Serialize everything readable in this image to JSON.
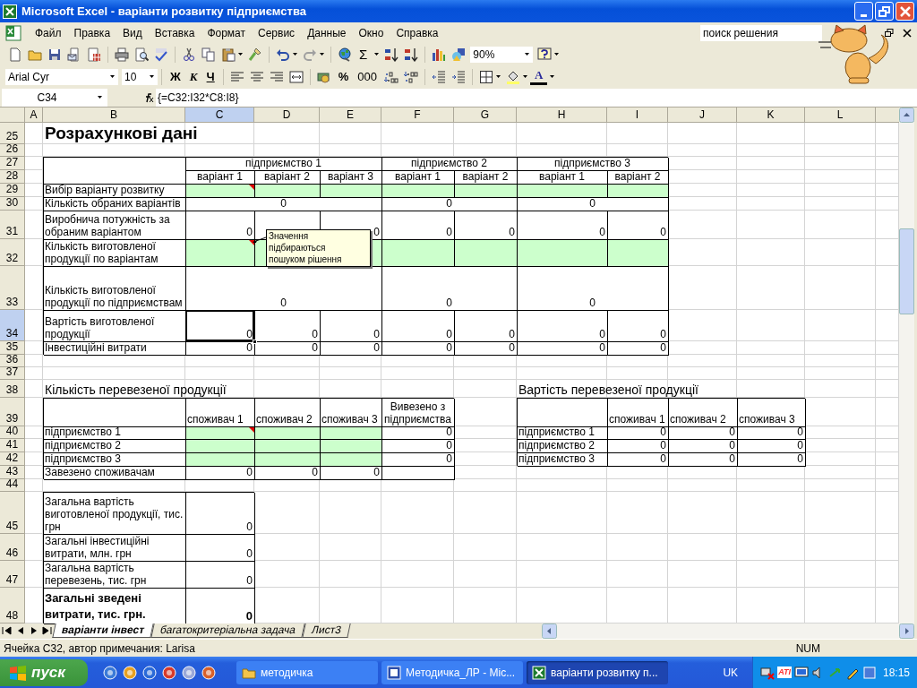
{
  "window": {
    "title": "Microsoft Excel - варіанти розвитку підприємства"
  },
  "menu": [
    "Файл",
    "Правка",
    "Вид",
    "Вставка",
    "Формат",
    "Сервис",
    "Данные",
    "Окно",
    "Справка"
  ],
  "help_search": {
    "value": "поиск решения"
  },
  "toolbar_standard": [
    {
      "kind": "icon"
    },
    {
      "kind": "icon"
    },
    {
      "kind": "icon"
    },
    {
      "kind": "icon"
    },
    {
      "kind": "icon"
    },
    {
      "kind": "separator"
    },
    {
      "kind": "icon"
    },
    {
      "kind": "icon"
    },
    {
      "kind": "icon"
    },
    {
      "kind": "separator"
    },
    {
      "kind": "icon"
    },
    {
      "kind": "icon"
    },
    {
      "kind": "icon_menu"
    },
    {
      "kind": "icon"
    },
    {
      "kind": "separator"
    },
    {
      "kind": "icon_menu"
    },
    {
      "kind": "icon_menu"
    },
    {
      "kind": "separator"
    },
    {
      "kind": "icon"
    },
    {
      "kind": "text_menu",
      "label": "Σ"
    },
    {
      "kind": "icon"
    },
    {
      "kind": "icon"
    },
    {
      "kind": "separator"
    },
    {
      "kind": "icon"
    },
    {
      "kind": "icon"
    },
    {
      "kind": "zoom_combo",
      "value": "90%"
    },
    {
      "kind": "icon_menu"
    }
  ],
  "toolbar_formatting": [
    {
      "kind": "font_combo",
      "value": "Arial Cyr"
    },
    {
      "kind": "size_combo",
      "value": "10"
    },
    {
      "kind": "separator"
    },
    {
      "kind": "text",
      "label": "Ж"
    },
    {
      "kind": "text",
      "label": "К"
    },
    {
      "kind": "text",
      "label": "Ч"
    },
    {
      "kind": "separator"
    },
    {
      "kind": "icon"
    },
    {
      "kind": "icon"
    },
    {
      "kind": "icon"
    },
    {
      "kind": "icon"
    },
    {
      "kind": "separator"
    },
    {
      "kind": "icon"
    },
    {
      "kind": "text",
      "label": "%"
    },
    {
      "kind": "text",
      "label": "000"
    },
    {
      "kind": "icon"
    },
    {
      "kind": "icon"
    },
    {
      "kind": "separator"
    },
    {
      "kind": "icon"
    },
    {
      "kind": "icon"
    },
    {
      "kind": "separator"
    },
    {
      "kind": "icon_menu"
    },
    {
      "kind": "icon_menu"
    },
    {
      "kind": "text_menu",
      "label": "A"
    }
  ],
  "formula_bar": {
    "name_box": "C34",
    "formula": "{=C32:I32*C8:I8}"
  },
  "sheet": {
    "columns": [
      {
        "label": "A",
        "selected": false
      },
      {
        "label": "B",
        "selected": false
      },
      {
        "label": "C",
        "selected": true
      },
      {
        "label": "D",
        "selected": false
      },
      {
        "label": "E",
        "selected": false
      },
      {
        "label": "F",
        "selected": false
      },
      {
        "label": "G",
        "selected": false
      },
      {
        "label": "H",
        "selected": false
      },
      {
        "label": "I",
        "selected": false
      },
      {
        "label": "J",
        "selected": false
      },
      {
        "label": "K",
        "selected": false
      },
      {
        "label": "L",
        "selected": false
      }
    ],
    "rows": [
      {
        "number": "25",
        "selected": false,
        "cells": [
          {
            "kind": "none"
          },
          {
            "kind": "title",
            "text": "Розрахункові дані"
          }
        ]
      },
      {
        "number": "26",
        "selected": false
      },
      {
        "number": "27",
        "selected": false,
        "cells": [
          {
            "kind": "none"
          },
          {
            "kind": "blank"
          },
          {
            "kind": "header",
            "text": "підприємство 1"
          },
          {
            "kind": "merged"
          },
          {
            "kind": "merged"
          },
          {
            "kind": "header",
            "text": "підприємство 2"
          },
          {
            "kind": "merged"
          },
          {
            "kind": "header",
            "text": "підприємство 3"
          },
          {
            "kind": "merged"
          }
        ]
      },
      {
        "number": "28",
        "selected": false,
        "cells": [
          {
            "kind": "none"
          },
          {
            "kind": "merged_above"
          },
          {
            "kind": "header",
            "text": "варіант 1"
          },
          {
            "kind": "header",
            "text": "варіант 2"
          },
          {
            "kind": "header",
            "text": "варіант 3"
          },
          {
            "kind": "header",
            "text": "варіант 1"
          },
          {
            "kind": "header",
            "text": "варіант 2"
          },
          {
            "kind": "header",
            "text": "варіант 1"
          },
          {
            "kind": "header",
            "text": "варіант 2"
          }
        ]
      },
      {
        "number": "29",
        "selected": false,
        "cells": [
          {
            "kind": "none"
          },
          {
            "kind": "label",
            "text": "Вибір варіанту розвитку"
          },
          {
            "kind": "input",
            "comment": true
          },
          {
            "kind": "input",
            "comment": false
          },
          {
            "kind": "input",
            "comment": false
          },
          {
            "kind": "input",
            "comment": false
          },
          {
            "kind": "input",
            "comment": false
          },
          {
            "kind": "input",
            "comment": false
          },
          {
            "kind": "input",
            "comment": false
          }
        ]
      },
      {
        "number": "30",
        "selected": false,
        "cells": [
          {
            "kind": "none"
          },
          {
            "kind": "label",
            "text": "Кількість обраних варіантів"
          },
          {
            "kind": "center",
            "text": "0"
          },
          {
            "kind": "merged"
          },
          {
            "kind": "merged"
          },
          {
            "kind": "center",
            "text": "0"
          },
          {
            "kind": "merged"
          },
          {
            "kind": "center",
            "text": "0"
          },
          {
            "kind": "merged"
          }
        ]
      },
      {
        "number": "31",
        "selected": false,
        "cells": [
          {
            "kind": "none"
          },
          {
            "kind": "label",
            "text": "Виробнича потужність за обраним варіантом"
          },
          {
            "kind": "number",
            "text": "0"
          },
          {
            "kind": "blank"
          },
          {
            "kind": "number",
            "text": "0"
          },
          {
            "kind": "number",
            "text": "0"
          },
          {
            "kind": "number",
            "text": "0"
          },
          {
            "kind": "number",
            "text": "0"
          },
          {
            "kind": "number",
            "text": "0"
          }
        ]
      },
      {
        "number": "32",
        "selected": false,
        "cells": [
          {
            "kind": "none"
          },
          {
            "kind": "label",
            "text": "Кількість виготовленої продукції по варіантам"
          },
          {
            "kind": "input",
            "comment": true
          },
          {
            "kind": "input",
            "comment": false
          },
          {
            "kind": "input",
            "comment": false
          },
          {
            "kind": "input",
            "comment": false
          },
          {
            "kind": "input",
            "comment": false
          },
          {
            "kind": "input",
            "comment": false
          },
          {
            "kind": "input",
            "comment": false
          }
        ]
      },
      {
        "number": "33",
        "selected": false,
        "cells": [
          {
            "kind": "none"
          },
          {
            "kind": "label",
            "text": "Кількість виготовленої продукції по підприємствам"
          },
          {
            "kind": "center",
            "text": "0"
          },
          {
            "kind": "merged"
          },
          {
            "kind": "merged"
          },
          {
            "kind": "center",
            "text": "0"
          },
          {
            "kind": "merged"
          },
          {
            "kind": "center",
            "text": "0"
          },
          {
            "kind": "merged"
          }
        ]
      },
      {
        "number": "34",
        "selected": true,
        "cells": [
          {
            "kind": "none"
          },
          {
            "kind": "label",
            "text": "Вартість виготовленої продукції"
          },
          {
            "kind": "number",
            "text": "0"
          },
          {
            "kind": "number",
            "text": "0"
          },
          {
            "kind": "number",
            "text": "0"
          },
          {
            "kind": "number",
            "text": "0"
          },
          {
            "kind": "number",
            "text": "0"
          },
          {
            "kind": "number",
            "text": "0"
          },
          {
            "kind": "number",
            "text": "0"
          }
        ]
      },
      {
        "number": "35",
        "selected": false,
        "cells": [
          {
            "kind": "none"
          },
          {
            "kind": "label",
            "text": "Інвестиційні витрати"
          },
          {
            "kind": "number",
            "text": "0"
          },
          {
            "kind": "number",
            "text": "0"
          },
          {
            "kind": "number",
            "text": "0"
          },
          {
            "kind": "number",
            "text": "0"
          },
          {
            "kind": "number",
            "text": "0"
          },
          {
            "kind": "number",
            "text": "0"
          },
          {
            "kind": "number",
            "text": "0"
          }
        ]
      },
      {
        "number": "36",
        "selected": false
      },
      {
        "number": "37",
        "selected": false
      },
      {
        "number": "38",
        "selected": false,
        "cells": [
          {
            "kind": "none"
          },
          {
            "kind": "heading",
            "text": "Кількість перевезеної продукції"
          },
          {
            "kind": "none"
          },
          {
            "kind": "none"
          },
          {
            "kind": "none"
          },
          {
            "kind": "none"
          },
          {
            "kind": "none"
          },
          {
            "kind": "heading",
            "text": "Вартість перевезеної продукції"
          }
        ]
      },
      {
        "number": "39",
        "selected": false,
        "cells": [
          {
            "kind": "none"
          },
          {
            "kind": "blank"
          },
          {
            "kind": "label",
            "text": "споживач 1"
          },
          {
            "kind": "label",
            "text": "споживач 2"
          },
          {
            "kind": "label",
            "text": "споживач 3"
          },
          {
            "kind": "header",
            "text": "Вивезено з підприємства"
          },
          {
            "kind": "none"
          },
          {
            "kind": "blank"
          },
          {
            "kind": "label",
            "text": "споживач 1"
          },
          {
            "kind": "label",
            "text": "споживач 2"
          },
          {
            "kind": "label",
            "text": "споживач 3"
          }
        ]
      },
      {
        "number": "40",
        "selected": false,
        "cells": [
          {
            "kind": "none"
          },
          {
            "kind": "label",
            "text": "підприємство 1"
          },
          {
            "kind": "input",
            "comment": true
          },
          {
            "kind": "input",
            "comment": false
          },
          {
            "kind": "input",
            "comment": false
          },
          {
            "kind": "number",
            "text": "0"
          },
          {
            "kind": "none"
          },
          {
            "kind": "label",
            "text": "підприємство 1"
          },
          {
            "kind": "number",
            "text": "0"
          },
          {
            "kind": "number",
            "text": "0"
          },
          {
            "kind": "number",
            "text": "0"
          }
        ]
      },
      {
        "number": "41",
        "selected": false,
        "cells": [
          {
            "kind": "none"
          },
          {
            "kind": "label",
            "text": "підприємство 2"
          },
          {
            "kind": "input",
            "comment": false
          },
          {
            "kind": "input",
            "comment": false
          },
          {
            "kind": "input",
            "comment": false
          },
          {
            "kind": "number",
            "text": "0"
          },
          {
            "kind": "none"
          },
          {
            "kind": "label",
            "text": "підприємство 2"
          },
          {
            "kind": "number",
            "text": "0"
          },
          {
            "kind": "number",
            "text": "0"
          },
          {
            "kind": "number",
            "text": "0"
          }
        ]
      },
      {
        "number": "42",
        "selected": false,
        "cells": [
          {
            "kind": "none"
          },
          {
            "kind": "label",
            "text": "підприємство 3"
          },
          {
            "kind": "input",
            "comment": false
          },
          {
            "kind": "input",
            "comment": false
          },
          {
            "kind": "input",
            "comment": false
          },
          {
            "kind": "number",
            "text": "0"
          },
          {
            "kind": "none"
          },
          {
            "kind": "label",
            "text": "підприємство 3"
          },
          {
            "kind": "number",
            "text": "0"
          },
          {
            "kind": "number",
            "text": "0"
          },
          {
            "kind": "number",
            "text": "0"
          }
        ]
      },
      {
        "number": "43",
        "selected": false,
        "cells": [
          {
            "kind": "none"
          },
          {
            "kind": "label",
            "text": "Завезено споживачам"
          },
          {
            "kind": "number",
            "text": "0"
          },
          {
            "kind": "number",
            "text": "0"
          },
          {
            "kind": "number",
            "text": "0"
          },
          {
            "kind": "blank"
          }
        ]
      },
      {
        "number": "44",
        "selected": false
      },
      {
        "number": "45",
        "selected": false,
        "cells": [
          {
            "kind": "none"
          },
          {
            "kind": "label",
            "text": "Загальна вартість виготовленої продукції, тис. грн"
          },
          {
            "kind": "number",
            "text": "0"
          }
        ]
      },
      {
        "number": "46",
        "selected": false,
        "cells": [
          {
            "kind": "none"
          },
          {
            "kind": "label",
            "text": "Загальні інвестиційні витрати, млн. грн"
          },
          {
            "kind": "number",
            "text": "0"
          }
        ]
      },
      {
        "number": "47",
        "selected": false,
        "cells": [
          {
            "kind": "none"
          },
          {
            "kind": "label",
            "text": "Загальна вартість перевезень, тис. грн"
          },
          {
            "kind": "number",
            "text": "0"
          }
        ]
      },
      {
        "number": "48",
        "selected": false,
        "cells": [
          {
            "kind": "none"
          },
          {
            "kind": "total_label",
            "text": "Загальні зведені витрати, тис. грн."
          },
          {
            "kind": "total",
            "text": "0"
          }
        ]
      }
    ],
    "comment": {
      "text": "Значення підбираються пошуком рішення"
    }
  },
  "sheet_tabs": [
    {
      "label": "варіанти інвест",
      "selected": true
    },
    {
      "label": "багатокритеріальна задача",
      "selected": false
    },
    {
      "label": "Лист3",
      "selected": false
    }
  ],
  "status_bar": {
    "message": "Ячейка C32, автор примечания: Larisa",
    "indicator": "NUM"
  },
  "taskbar": {
    "start": "пуск",
    "tasks": [
      {
        "label": "методичка",
        "selected": false
      },
      {
        "label": "Методичка_ЛР - Mic...",
        "selected": false
      },
      {
        "label": "варіанти розвитку п...",
        "selected": true
      }
    ],
    "language": "UK",
    "tray_label": "ATI",
    "clock": "18:15"
  }
}
